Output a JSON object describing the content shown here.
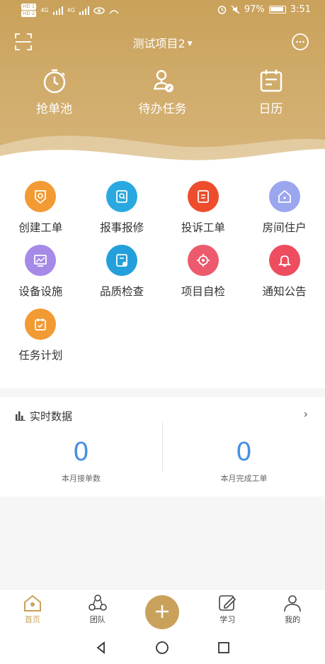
{
  "status_bar": {
    "network_tags": [
      "HD 1",
      "HD 2"
    ],
    "signal_a": "4G",
    "signal_b": "4G",
    "battery_percent": "97%",
    "time": "3:51"
  },
  "top_bar": {
    "project_name": "测试项目2"
  },
  "quick_actions": [
    {
      "label": "抢单池",
      "icon": "stopwatch-icon"
    },
    {
      "label": "待办任务",
      "icon": "task-pen-icon"
    },
    {
      "label": "日历",
      "icon": "calendar-icon"
    }
  ],
  "functions": [
    {
      "label": "创建工单",
      "icon": "create-order-icon",
      "color": "#f29a33"
    },
    {
      "label": "报事报修",
      "icon": "repair-report-icon",
      "color": "#2aa8e0"
    },
    {
      "label": "投诉工单",
      "icon": "complaint-icon",
      "color": "#ee4d2d"
    },
    {
      "label": "房间住户",
      "icon": "house-icon",
      "color": "#9aa6ee"
    },
    {
      "label": "设备设施",
      "icon": "equipment-icon",
      "color": "#a58ae8"
    },
    {
      "label": "品质检查",
      "icon": "quality-check-icon",
      "color": "#23a0db"
    },
    {
      "label": "项目自检",
      "icon": "target-icon",
      "color": "#ec5b6d"
    },
    {
      "label": "通知公告",
      "icon": "bell-icon",
      "color": "#ee4d5f"
    },
    {
      "label": "任务计划",
      "icon": "task-plan-icon",
      "color": "#f29a33"
    }
  ],
  "realtime": {
    "title": "实时数据",
    "stats": [
      {
        "value": "0",
        "caption": "本月接单数"
      },
      {
        "value": "0",
        "caption": "本月完成工单"
      }
    ]
  },
  "tabs": [
    {
      "label": "首页",
      "icon": "home-icon",
      "active": true
    },
    {
      "label": "团队",
      "icon": "team-icon",
      "active": false
    },
    {
      "label": "",
      "icon": "plus-icon",
      "active": false
    },
    {
      "label": "学习",
      "icon": "study-icon",
      "active": false
    },
    {
      "label": "我的",
      "icon": "profile-icon",
      "active": false
    }
  ],
  "colors": {
    "brand": "#c9a15a",
    "stat_number": "#4a90e2"
  }
}
